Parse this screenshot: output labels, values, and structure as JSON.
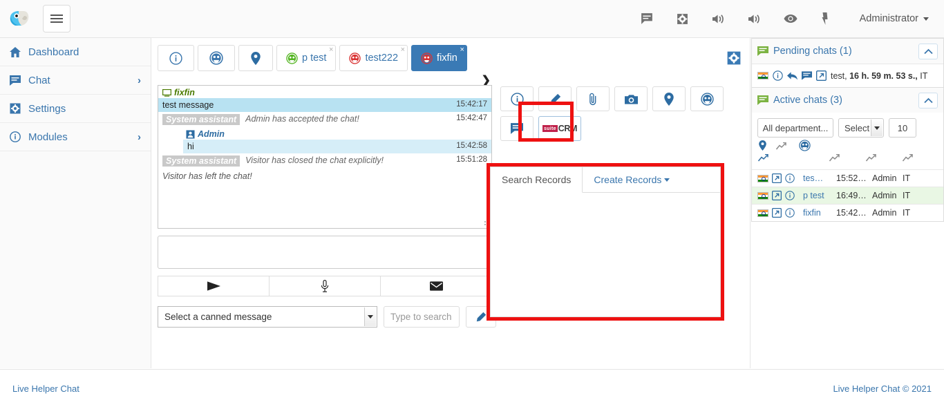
{
  "app": {
    "logo_icon": "parrot-logo",
    "menu_toggle_icon": "hamburger-icon"
  },
  "topbar": {
    "icons": [
      {
        "name": "chat-icon",
        "glyph": "chat"
      },
      {
        "name": "gear-icon",
        "glyph": "gear"
      },
      {
        "name": "volume-icon-1",
        "glyph": "volume"
      },
      {
        "name": "volume-icon-2",
        "glyph": "volume"
      },
      {
        "name": "eye-icon",
        "glyph": "eye"
      },
      {
        "name": "bolt-icon",
        "glyph": "bolt"
      }
    ],
    "user_label": "Administrator"
  },
  "sidebar": {
    "items": [
      {
        "label": "Dashboard",
        "icon": "home-icon",
        "chevron": false
      },
      {
        "label": "Chat",
        "icon": "chat-icon",
        "chevron": true
      },
      {
        "label": "Settings",
        "icon": "gear-icon",
        "chevron": false
      },
      {
        "label": "Modules",
        "icon": "info-circle-icon",
        "chevron": true
      }
    ],
    "chevron_glyph": "›"
  },
  "main": {
    "tabs": [
      {
        "label": "",
        "icon": "info-circle-icon",
        "active": false,
        "closable": false
      },
      {
        "label": "",
        "icon": "visitor-face-icon",
        "active": false,
        "closable": false
      },
      {
        "label": "",
        "icon": "map-pin-icon",
        "active": false,
        "closable": false
      },
      {
        "label": "p test",
        "icon": "face-green-icon",
        "active": false,
        "closable": true,
        "close_glyph": "×"
      },
      {
        "label": "test222",
        "icon": "face-red-icon",
        "active": false,
        "closable": true,
        "close_glyph": "×"
      },
      {
        "label": "fixfin",
        "icon": "face-red-icon",
        "active": true,
        "closable": true,
        "close_glyph": "×"
      }
    ],
    "settings_icon": "gear-icon",
    "collapse_glyph": "❯"
  },
  "transcript": {
    "visitor_name": "fixfin",
    "visitor_icon": "monitor-icon",
    "admin_name": "Admin",
    "admin_icon": "user-card-icon",
    "system_label": "System assistant",
    "messages": [
      {
        "kind": "visitor",
        "text": "test message",
        "time": "15:42:17"
      },
      {
        "kind": "system",
        "text": "Admin has accepted the chat!",
        "time": "15:42:47"
      },
      {
        "kind": "admin",
        "text": "hi",
        "time": "15:42:58"
      },
      {
        "kind": "system",
        "text": "Visitor has closed the chat explicitly!",
        "time": "15:51:28"
      },
      {
        "kind": "plain",
        "text": "Visitor has left the chat!",
        "time": ""
      }
    ]
  },
  "composer": {
    "message_value": "",
    "message_placeholder": "",
    "actions": [
      {
        "name": "send-button",
        "icon": "send-icon"
      },
      {
        "name": "voice-button",
        "icon": "microphone-icon"
      },
      {
        "name": "mail-button",
        "icon": "envelope-icon"
      }
    ],
    "canned_label": "Select a canned message",
    "search_placeholder": "Type to search",
    "search_value": "",
    "edit_icon": "pencil-icon"
  },
  "tools": {
    "buttons": [
      {
        "name": "chat-info-button",
        "icon": "info-circle-icon"
      },
      {
        "name": "edit-button",
        "icon": "pencil-icon"
      },
      {
        "name": "attachment-button",
        "icon": "paperclip-icon"
      },
      {
        "name": "screenshot-button",
        "icon": "camera-icon"
      },
      {
        "name": "location-button",
        "icon": "map-pin-icon"
      },
      {
        "name": "visitor-button",
        "icon": "face-icon"
      },
      {
        "name": "message-button",
        "icon": "chat-icon"
      }
    ],
    "crm": {
      "name": "suitecrm-button",
      "badge_text": "suite",
      "word": "CRM",
      "highlighted": true,
      "highlight_color": "#ee1111"
    }
  },
  "records": {
    "highlighted": true,
    "highlight_color": "#ee1111",
    "tabs": [
      {
        "label": "Search Records",
        "selected": true,
        "dropdown": false
      },
      {
        "label": "Create Records",
        "selected": false,
        "dropdown": true
      }
    ],
    "body_text": ""
  },
  "rightbar": {
    "pending": {
      "title": "Pending chats (1)",
      "icon": "chat-green-icon",
      "collapse_icon": "chevron-up-icon",
      "rows": [
        {
          "flag": "india-flag",
          "icons": [
            "info-circle-icon",
            "reply-arrow-icon",
            "chat-icon",
            "open-external-icon"
          ],
          "name": "test,",
          "duration": "16 h. 59 m. 53 s.,",
          "country": "IT"
        }
      ]
    },
    "active": {
      "title": "Active chats (3)",
      "icon": "chat-green-icon",
      "collapse_icon": "chevron-up-icon",
      "filters": {
        "department": "All department...",
        "select": "Select c",
        "limit": "10"
      },
      "column_icons": [
        "map-pin-icon",
        "trend-icon",
        "face-icon",
        "trend-icon",
        "trend-icon",
        "trend-icon",
        "trend-icon"
      ],
      "rows": [
        {
          "flag": "india-flag",
          "icons": [
            "open-external-icon",
            "info-circle-icon"
          ],
          "name": "tes…",
          "time": "15:52…",
          "user": "Admin",
          "country": "IT",
          "highlight": false
        },
        {
          "flag": "india-flag",
          "icons": [
            "open-external-icon",
            "info-circle-icon"
          ],
          "name": "p test",
          "time": "16:49…",
          "user": "Admin",
          "country": "IT",
          "highlight": true
        },
        {
          "flag": "india-flag",
          "icons": [
            "open-external-icon",
            "info-circle-icon"
          ],
          "name": "fixfin",
          "time": "15:42…",
          "user": "Admin",
          "country": "IT",
          "highlight": false
        }
      ]
    }
  },
  "footer": {
    "left_link": "Live Helper Chat",
    "right_text": "Live Helper Chat © 2021"
  }
}
